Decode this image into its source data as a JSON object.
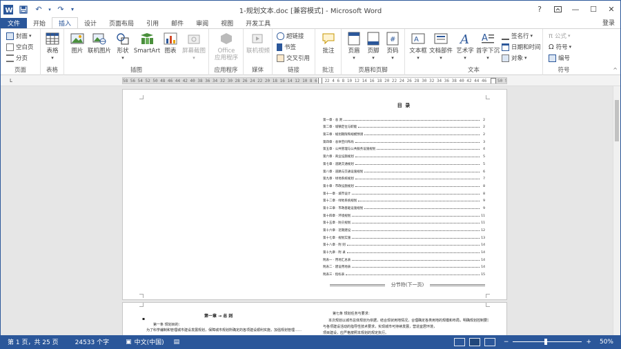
{
  "window": {
    "title": "1-规划文本.doc [兼容模式] - Microsoft Word",
    "controls": {
      "help": "?",
      "restore": "□",
      "minimize": "—",
      "maximize": "☐",
      "close": "✕"
    }
  },
  "tabs": [
    {
      "label": "文件"
    },
    {
      "label": "开始"
    },
    {
      "label": "插入"
    },
    {
      "label": "设计"
    },
    {
      "label": "页面布局"
    },
    {
      "label": "引用"
    },
    {
      "label": "邮件"
    },
    {
      "label": "审阅"
    },
    {
      "label": "视图"
    },
    {
      "label": "开发工具"
    }
  ],
  "active_tab": "插入",
  "login": "登录",
  "ribbon": {
    "pages": {
      "label": "页面",
      "cover": "封面",
      "blank": "空白页",
      "break": "分页"
    },
    "tables": {
      "label": "表格",
      "table": "表格"
    },
    "illustrations": {
      "label": "插图",
      "picture": "图片",
      "online_picture": "联机图片",
      "shapes": "形状",
      "smartart": "SmartArt",
      "chart": "图表",
      "screenshot": "屏幕截图"
    },
    "apps": {
      "label": "应用程序",
      "office_apps": "Office\n应用程序"
    },
    "media": {
      "label": "媒体",
      "online_video": "联机视频"
    },
    "links": {
      "label": "链接",
      "hyperlink": "超链接",
      "bookmark": "书签",
      "crossref": "交叉引用"
    },
    "comments": {
      "label": "批注",
      "comment": "批注"
    },
    "header_footer": {
      "label": "页眉和页脚",
      "header": "页眉",
      "footer": "页脚",
      "page_number": "页码"
    },
    "text": {
      "label": "文本",
      "textbox": "文本框",
      "quickparts": "文档部件",
      "wordart": "艺术字",
      "dropcap": "首字下沉",
      "signature": "签名行",
      "datetime": "日期和时间",
      "object": "对象"
    },
    "symbols": {
      "label": "符号",
      "equation": "公式",
      "symbol": "符号",
      "numbering": "编号"
    }
  },
  "ruler": {
    "numbers": "58 56 54 52 50 48 46 44 42 40 38 36 34 32 30 28 26 24 22 20 18 16 14 12 10 8 6 4 2",
    "numbers_right": "2 4 6 8 10 12 14 16 18 20 22 24 26 28 30 32 34 36 38 40 42 44 46",
    "numbers_end": "50 52 54"
  },
  "toc": {
    "title": "目  录",
    "entries": [
      {
        "title": "第一章 · 总  则",
        "page": "2"
      },
      {
        "title": "第二章 · 城镇定位与职能",
        "page": "2"
      },
      {
        "title": "第三章 · 规划期限和规模预测",
        "page": "2"
      },
      {
        "title": "第四章 · 总体空间布局",
        "page": "3"
      },
      {
        "title": "第五章 · 公共管理与公共服务设施规划",
        "page": "4"
      },
      {
        "title": "第六章 · 商业设施规划",
        "page": "5"
      },
      {
        "title": "第七章 · 道路交通规划",
        "page": "5"
      },
      {
        "title": "第八章 · 道路与交通设施规划",
        "page": "6"
      },
      {
        "title": "第九章 · 绿地系统规划",
        "page": "7"
      },
      {
        "title": "第十章 · 市政设施规划",
        "page": "8"
      },
      {
        "title": "第十一章 · 城市设计",
        "page": "8"
      },
      {
        "title": "第十二章 · 绿地系统规划",
        "page": "9"
      },
      {
        "title": "第十三章 · 市政基础设施规划",
        "page": "9"
      },
      {
        "title": "第十四章 · 环境规划",
        "page": "11"
      },
      {
        "title": "第十五章 · 防灾规划",
        "page": "11"
      },
      {
        "title": "第十六章 · 近期建设",
        "page": "12"
      },
      {
        "title": "第十七章 · 规划实施",
        "page": "13"
      },
      {
        "title": "第十八章 · 附  则",
        "page": "14"
      },
      {
        "title": "第十九章 · 附  录",
        "page": "14"
      },
      {
        "title": "附表一 · 用地汇总表",
        "page": "14"
      },
      {
        "title": "附表二 · 建设用地表",
        "page": "14"
      },
      {
        "title": "附表三 · 指标表",
        "page": "15"
      }
    ]
  },
  "section_break": "分节符(下一页)",
  "page2": {
    "chapter_title": "第一章 → 总  则",
    "article1": "第一条  规划目的：",
    "article1_text": "为了科学编制和管理城市建设发展规划，保障城市规划所确定的各项建设顺利实施，加强规划管理……",
    "article7": "第七条  规划任务与要求：",
    "article7_text": "本次规划以城市总体规划为依据，结合现状用地情况，合理确定各类用地的规模和布局，明确规划控制要求，",
    "article7_text2": "与各项建设活动的指导性技术要求，实现城市可持续发展，营造宜居环境，",
    "article7_text3": "项目建设，应严格按照本规划的规定执行。"
  },
  "status": {
    "page": "第 1 页，共 25 页",
    "words": "24533 个字",
    "lang": "中文(中国)",
    "zoom": "50%"
  }
}
